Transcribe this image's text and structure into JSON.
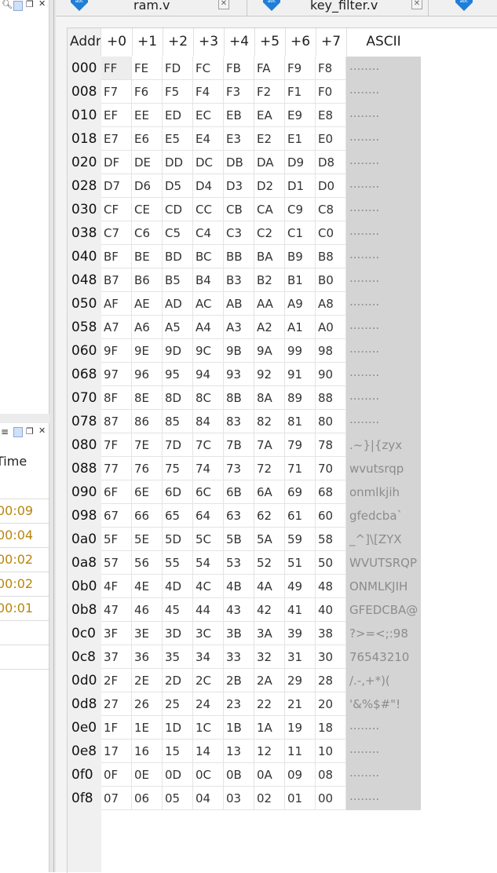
{
  "left_panel": {
    "time_header": "Time",
    "times": [
      "00:09",
      "00:04",
      "00:02",
      "00:02",
      "00:01"
    ]
  },
  "tabs": [
    {
      "label": "ram.v",
      "icon": "verilog-file-icon"
    },
    {
      "label": "key_filter.v",
      "icon": "verilog-file-icon"
    }
  ],
  "memory": {
    "headers": [
      "Addr",
      "+0",
      "+1",
      "+2",
      "+3",
      "+4",
      "+5",
      "+6",
      "+7",
      "ASCII"
    ],
    "rows": [
      {
        "addr": "000",
        "bytes": [
          "FF",
          "FE",
          "FD",
          "FC",
          "FB",
          "FA",
          "F9",
          "F8"
        ],
        "ascii": "........"
      },
      {
        "addr": "008",
        "bytes": [
          "F7",
          "F6",
          "F5",
          "F4",
          "F3",
          "F2",
          "F1",
          "F0"
        ],
        "ascii": "........"
      },
      {
        "addr": "010",
        "bytes": [
          "EF",
          "EE",
          "ED",
          "EC",
          "EB",
          "EA",
          "E9",
          "E8"
        ],
        "ascii": "........"
      },
      {
        "addr": "018",
        "bytes": [
          "E7",
          "E6",
          "E5",
          "E4",
          "E3",
          "E2",
          "E1",
          "E0"
        ],
        "ascii": "........"
      },
      {
        "addr": "020",
        "bytes": [
          "DF",
          "DE",
          "DD",
          "DC",
          "DB",
          "DA",
          "D9",
          "D8"
        ],
        "ascii": "........"
      },
      {
        "addr": "028",
        "bytes": [
          "D7",
          "D6",
          "D5",
          "D4",
          "D3",
          "D2",
          "D1",
          "D0"
        ],
        "ascii": "........"
      },
      {
        "addr": "030",
        "bytes": [
          "CF",
          "CE",
          "CD",
          "CC",
          "CB",
          "CA",
          "C9",
          "C8"
        ],
        "ascii": "........"
      },
      {
        "addr": "038",
        "bytes": [
          "C7",
          "C6",
          "C5",
          "C4",
          "C3",
          "C2",
          "C1",
          "C0"
        ],
        "ascii": "........"
      },
      {
        "addr": "040",
        "bytes": [
          "BF",
          "BE",
          "BD",
          "BC",
          "BB",
          "BA",
          "B9",
          "B8"
        ],
        "ascii": "........"
      },
      {
        "addr": "048",
        "bytes": [
          "B7",
          "B6",
          "B5",
          "B4",
          "B3",
          "B2",
          "B1",
          "B0"
        ],
        "ascii": "........"
      },
      {
        "addr": "050",
        "bytes": [
          "AF",
          "AE",
          "AD",
          "AC",
          "AB",
          "AA",
          "A9",
          "A8"
        ],
        "ascii": "........"
      },
      {
        "addr": "058",
        "bytes": [
          "A7",
          "A6",
          "A5",
          "A4",
          "A3",
          "A2",
          "A1",
          "A0"
        ],
        "ascii": "........"
      },
      {
        "addr": "060",
        "bytes": [
          "9F",
          "9E",
          "9D",
          "9C",
          "9B",
          "9A",
          "99",
          "98"
        ],
        "ascii": "........"
      },
      {
        "addr": "068",
        "bytes": [
          "97",
          "96",
          "95",
          "94",
          "93",
          "92",
          "91",
          "90"
        ],
        "ascii": "........"
      },
      {
        "addr": "070",
        "bytes": [
          "8F",
          "8E",
          "8D",
          "8C",
          "8B",
          "8A",
          "89",
          "88"
        ],
        "ascii": "........"
      },
      {
        "addr": "078",
        "bytes": [
          "87",
          "86",
          "85",
          "84",
          "83",
          "82",
          "81",
          "80"
        ],
        "ascii": "........"
      },
      {
        "addr": "080",
        "bytes": [
          "7F",
          "7E",
          "7D",
          "7C",
          "7B",
          "7A",
          "79",
          "78"
        ],
        "ascii": ".~}|{zyx"
      },
      {
        "addr": "088",
        "bytes": [
          "77",
          "76",
          "75",
          "74",
          "73",
          "72",
          "71",
          "70"
        ],
        "ascii": "wvutsrqp"
      },
      {
        "addr": "090",
        "bytes": [
          "6F",
          "6E",
          "6D",
          "6C",
          "6B",
          "6A",
          "69",
          "68"
        ],
        "ascii": "onmlkjih"
      },
      {
        "addr": "098",
        "bytes": [
          "67",
          "66",
          "65",
          "64",
          "63",
          "62",
          "61",
          "60"
        ],
        "ascii": "gfedcba`"
      },
      {
        "addr": "0a0",
        "bytes": [
          "5F",
          "5E",
          "5D",
          "5C",
          "5B",
          "5A",
          "59",
          "58"
        ],
        "ascii": "_^]\\[ZYX"
      },
      {
        "addr": "0a8",
        "bytes": [
          "57",
          "56",
          "55",
          "54",
          "53",
          "52",
          "51",
          "50"
        ],
        "ascii": "WVUTSRQP"
      },
      {
        "addr": "0b0",
        "bytes": [
          "4F",
          "4E",
          "4D",
          "4C",
          "4B",
          "4A",
          "49",
          "48"
        ],
        "ascii": "ONMLKJIH"
      },
      {
        "addr": "0b8",
        "bytes": [
          "47",
          "46",
          "45",
          "44",
          "43",
          "42",
          "41",
          "40"
        ],
        "ascii": "GFEDCBA@"
      },
      {
        "addr": "0c0",
        "bytes": [
          "3F",
          "3E",
          "3D",
          "3C",
          "3B",
          "3A",
          "39",
          "38"
        ],
        "ascii": "?>=<;:98"
      },
      {
        "addr": "0c8",
        "bytes": [
          "37",
          "36",
          "35",
          "34",
          "33",
          "32",
          "31",
          "30"
        ],
        "ascii": "76543210"
      },
      {
        "addr": "0d0",
        "bytes": [
          "2F",
          "2E",
          "2D",
          "2C",
          "2B",
          "2A",
          "29",
          "28"
        ],
        "ascii": "/.-,+*)("
      },
      {
        "addr": "0d8",
        "bytes": [
          "27",
          "26",
          "25",
          "24",
          "23",
          "22",
          "21",
          "20"
        ],
        "ascii": "'&%$#\"!"
      },
      {
        "addr": "0e0",
        "bytes": [
          "1F",
          "1E",
          "1D",
          "1C",
          "1B",
          "1A",
          "19",
          "18"
        ],
        "ascii": "........"
      },
      {
        "addr": "0e8",
        "bytes": [
          "17",
          "16",
          "15",
          "14",
          "13",
          "12",
          "11",
          "10"
        ],
        "ascii": "........"
      },
      {
        "addr": "0f0",
        "bytes": [
          "0F",
          "0E",
          "0D",
          "0C",
          "0B",
          "0A",
          "09",
          "08"
        ],
        "ascii": "........"
      },
      {
        "addr": "0f8",
        "bytes": [
          "07",
          "06",
          "05",
          "04",
          "03",
          "02",
          "01",
          "00"
        ],
        "ascii": "........"
      }
    ]
  },
  "colors": {
    "time_text": "#b8860b",
    "ascii_bg": "#d4d4d4",
    "abc_icon": "#1e7fd8"
  }
}
